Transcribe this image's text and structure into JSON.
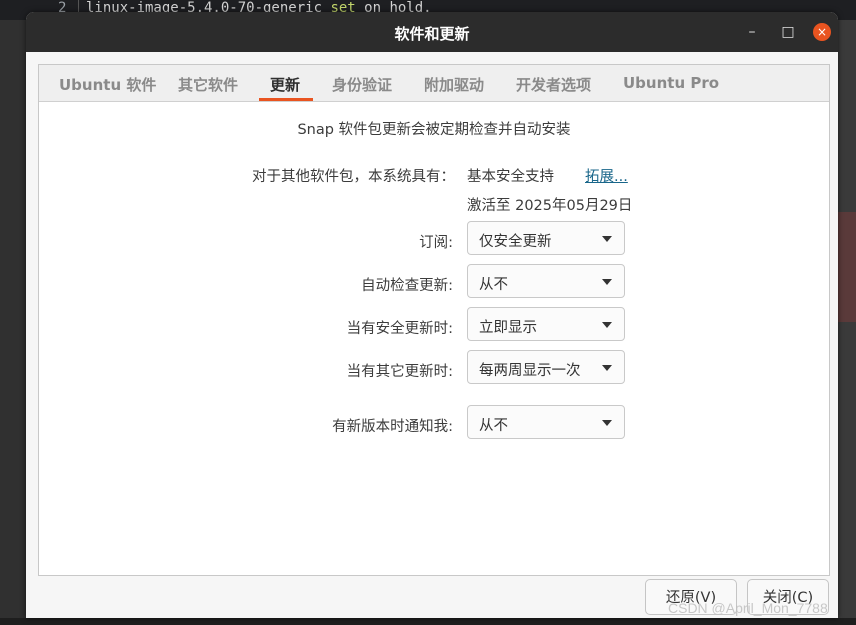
{
  "terminal": {
    "line_number": "2",
    "code_text": "linux-image-5.4.0-70-generic ",
    "keyword": "set",
    "code_tail": " on hold."
  },
  "window": {
    "title": "软件和更新",
    "controls": {
      "minimize": "–",
      "maximize": "□",
      "close": "×"
    }
  },
  "tabs": [
    {
      "label": "Ubuntu 软件"
    },
    {
      "label": "其它软件"
    },
    {
      "label": "更新",
      "active": true
    },
    {
      "label": "身份验证"
    },
    {
      "label": "附加驱动"
    },
    {
      "label": "开发者选项"
    },
    {
      "label": "Ubuntu Pro"
    }
  ],
  "updates": {
    "snap_note": "Snap 软件包更新会被定期检查并自动安装",
    "other_packages_label": "对于其他软件包，本系统具有：",
    "support_status": "基本安全支持",
    "extend_link": "拓展...",
    "activation": "激活至 2025年05月29日",
    "subscription": {
      "label": "订阅:",
      "value": "仅安全更新"
    },
    "auto_check": {
      "label": "自动检查更新:",
      "value": "从不"
    },
    "security_updates": {
      "label": "当有安全更新时:",
      "value": "立即显示"
    },
    "other_updates": {
      "label": "当有其它更新时:",
      "value": "每两周显示一次"
    },
    "notify_new_version": {
      "label": "有新版本时通知我:",
      "value": "从不"
    }
  },
  "footer": {
    "revert_button": "还原(V)",
    "close_button": "关闭(C)"
  },
  "watermark": "CSDN @April_Mon_7788",
  "colors": {
    "accent": "#e95420",
    "titlebar": "#2c2c2c",
    "link": "#19668a"
  }
}
